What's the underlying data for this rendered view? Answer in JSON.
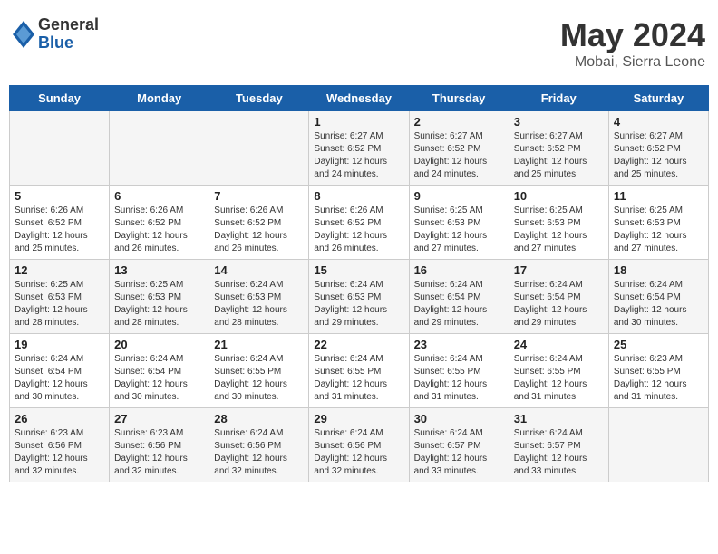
{
  "header": {
    "logo_general": "General",
    "logo_blue": "Blue",
    "month_title": "May 2024",
    "location": "Mobai, Sierra Leone"
  },
  "weekdays": [
    "Sunday",
    "Monday",
    "Tuesday",
    "Wednesday",
    "Thursday",
    "Friday",
    "Saturday"
  ],
  "weeks": [
    [
      {
        "day": "",
        "info": ""
      },
      {
        "day": "",
        "info": ""
      },
      {
        "day": "",
        "info": ""
      },
      {
        "day": "1",
        "info": "Sunrise: 6:27 AM\nSunset: 6:52 PM\nDaylight: 12 hours\nand 24 minutes."
      },
      {
        "day": "2",
        "info": "Sunrise: 6:27 AM\nSunset: 6:52 PM\nDaylight: 12 hours\nand 24 minutes."
      },
      {
        "day": "3",
        "info": "Sunrise: 6:27 AM\nSunset: 6:52 PM\nDaylight: 12 hours\nand 25 minutes."
      },
      {
        "day": "4",
        "info": "Sunrise: 6:27 AM\nSunset: 6:52 PM\nDaylight: 12 hours\nand 25 minutes."
      }
    ],
    [
      {
        "day": "5",
        "info": "Sunrise: 6:26 AM\nSunset: 6:52 PM\nDaylight: 12 hours\nand 25 minutes."
      },
      {
        "day": "6",
        "info": "Sunrise: 6:26 AM\nSunset: 6:52 PM\nDaylight: 12 hours\nand 26 minutes."
      },
      {
        "day": "7",
        "info": "Sunrise: 6:26 AM\nSunset: 6:52 PM\nDaylight: 12 hours\nand 26 minutes."
      },
      {
        "day": "8",
        "info": "Sunrise: 6:26 AM\nSunset: 6:52 PM\nDaylight: 12 hours\nand 26 minutes."
      },
      {
        "day": "9",
        "info": "Sunrise: 6:25 AM\nSunset: 6:53 PM\nDaylight: 12 hours\nand 27 minutes."
      },
      {
        "day": "10",
        "info": "Sunrise: 6:25 AM\nSunset: 6:53 PM\nDaylight: 12 hours\nand 27 minutes."
      },
      {
        "day": "11",
        "info": "Sunrise: 6:25 AM\nSunset: 6:53 PM\nDaylight: 12 hours\nand 27 minutes."
      }
    ],
    [
      {
        "day": "12",
        "info": "Sunrise: 6:25 AM\nSunset: 6:53 PM\nDaylight: 12 hours\nand 28 minutes."
      },
      {
        "day": "13",
        "info": "Sunrise: 6:25 AM\nSunset: 6:53 PM\nDaylight: 12 hours\nand 28 minutes."
      },
      {
        "day": "14",
        "info": "Sunrise: 6:24 AM\nSunset: 6:53 PM\nDaylight: 12 hours\nand 28 minutes."
      },
      {
        "day": "15",
        "info": "Sunrise: 6:24 AM\nSunset: 6:53 PM\nDaylight: 12 hours\nand 29 minutes."
      },
      {
        "day": "16",
        "info": "Sunrise: 6:24 AM\nSunset: 6:54 PM\nDaylight: 12 hours\nand 29 minutes."
      },
      {
        "day": "17",
        "info": "Sunrise: 6:24 AM\nSunset: 6:54 PM\nDaylight: 12 hours\nand 29 minutes."
      },
      {
        "day": "18",
        "info": "Sunrise: 6:24 AM\nSunset: 6:54 PM\nDaylight: 12 hours\nand 30 minutes."
      }
    ],
    [
      {
        "day": "19",
        "info": "Sunrise: 6:24 AM\nSunset: 6:54 PM\nDaylight: 12 hours\nand 30 minutes."
      },
      {
        "day": "20",
        "info": "Sunrise: 6:24 AM\nSunset: 6:54 PM\nDaylight: 12 hours\nand 30 minutes."
      },
      {
        "day": "21",
        "info": "Sunrise: 6:24 AM\nSunset: 6:55 PM\nDaylight: 12 hours\nand 30 minutes."
      },
      {
        "day": "22",
        "info": "Sunrise: 6:24 AM\nSunset: 6:55 PM\nDaylight: 12 hours\nand 31 minutes."
      },
      {
        "day": "23",
        "info": "Sunrise: 6:24 AM\nSunset: 6:55 PM\nDaylight: 12 hours\nand 31 minutes."
      },
      {
        "day": "24",
        "info": "Sunrise: 6:24 AM\nSunset: 6:55 PM\nDaylight: 12 hours\nand 31 minutes."
      },
      {
        "day": "25",
        "info": "Sunrise: 6:23 AM\nSunset: 6:55 PM\nDaylight: 12 hours\nand 31 minutes."
      }
    ],
    [
      {
        "day": "26",
        "info": "Sunrise: 6:23 AM\nSunset: 6:56 PM\nDaylight: 12 hours\nand 32 minutes."
      },
      {
        "day": "27",
        "info": "Sunrise: 6:23 AM\nSunset: 6:56 PM\nDaylight: 12 hours\nand 32 minutes."
      },
      {
        "day": "28",
        "info": "Sunrise: 6:24 AM\nSunset: 6:56 PM\nDaylight: 12 hours\nand 32 minutes."
      },
      {
        "day": "29",
        "info": "Sunrise: 6:24 AM\nSunset: 6:56 PM\nDaylight: 12 hours\nand 32 minutes."
      },
      {
        "day": "30",
        "info": "Sunrise: 6:24 AM\nSunset: 6:57 PM\nDaylight: 12 hours\nand 33 minutes."
      },
      {
        "day": "31",
        "info": "Sunrise: 6:24 AM\nSunset: 6:57 PM\nDaylight: 12 hours\nand 33 minutes."
      },
      {
        "day": "",
        "info": ""
      }
    ]
  ]
}
